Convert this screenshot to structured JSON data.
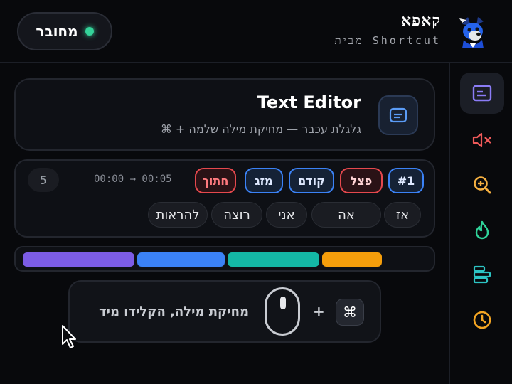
{
  "header": {
    "status_label": "מחובר",
    "brand_logo": "קאפא",
    "brand_sub": "מבית Shortcut"
  },
  "sidebar": {
    "items": [
      {
        "icon": "subtitles-icon",
        "color": "#8b7cf6",
        "active": true
      },
      {
        "icon": "mute-icon",
        "color": "#ef5a5a"
      },
      {
        "icon": "zoom-in-icon",
        "color": "#f5b041"
      },
      {
        "icon": "fire-icon",
        "color": "#2fd39a"
      },
      {
        "icon": "align-left-icon",
        "color": "#2cc4c4"
      },
      {
        "icon": "clock-icon",
        "color": "#f5a623"
      }
    ]
  },
  "card": {
    "title": "Text Editor",
    "subtitle": "⌘ + גלגלת עכבר — מחיקת מילה שלמה"
  },
  "segment": {
    "count": "5",
    "time_range": "00:00 → 00:05",
    "tags": [
      "#1",
      "פצל",
      "קודם",
      "מזג",
      "חתוך"
    ],
    "words": [
      "אז",
      "אה",
      "אני",
      "רוצה",
      "להראות"
    ]
  },
  "progress": {
    "segments": [
      {
        "color": "#7c5ce6",
        "fraction": 0.28
      },
      {
        "color": "#3b82f6",
        "fraction": 0.22
      },
      {
        "color": "#14b8a6",
        "fraction": 0.23
      },
      {
        "color": "#f59e0b",
        "fraction": 0.15
      }
    ]
  },
  "hint": {
    "text": "מחיקת מילה, הקלידו מיד",
    "plus": "+",
    "key": "⌘"
  },
  "colors": {
    "accent_green": "#34d399",
    "accent_blue": "#3b82f6",
    "accent_red": "#e5484d"
  }
}
